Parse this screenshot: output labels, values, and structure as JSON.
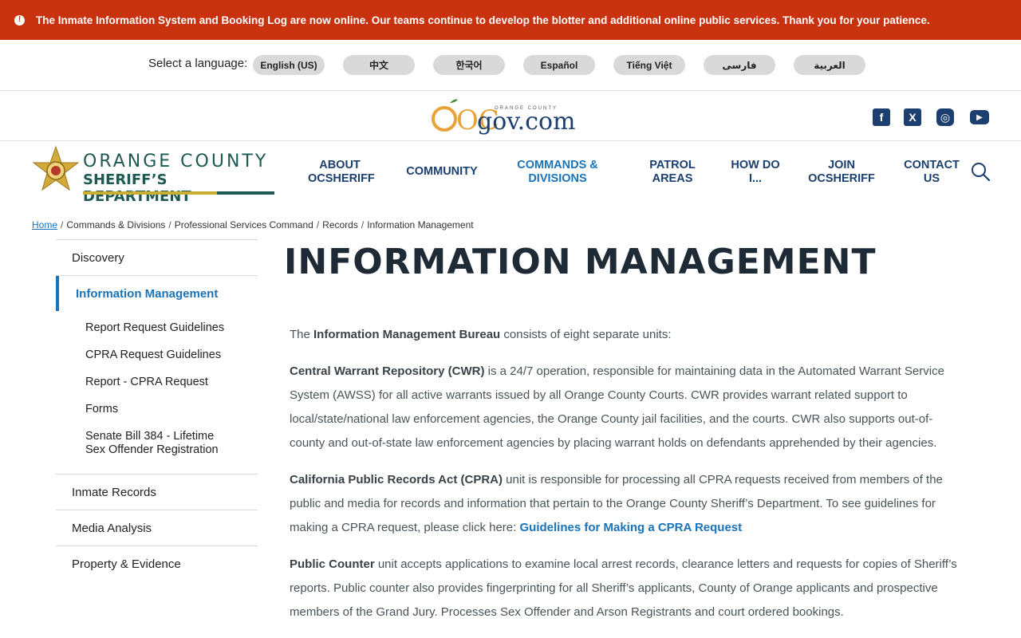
{
  "alert": {
    "icon": "alert-icon",
    "text": "The Inmate Information System and Booking Log are now online. Our teams continue to develop the blotter and additional online public services. Thank you for your patience."
  },
  "language": {
    "label": "Select a language:",
    "options": [
      "English (US)",
      "中文",
      "한국어",
      "Español",
      "Tiếng Việt",
      "فارسی",
      "العربية"
    ]
  },
  "ocgov": {
    "small_text": "ORANGE COUNTY",
    "oc": "OC",
    "site": "gov.com"
  },
  "social": {
    "facebook": "f",
    "x": "X",
    "instagram": "◎",
    "youtube": "▶"
  },
  "brand": {
    "line1": "ORANGE COUNTY",
    "line2": "SHERIFF’S DEPARTMENT"
  },
  "nav": [
    "ABOUT OCSHERIFF",
    "COMMUNITY",
    "COMMANDS & DIVISIONS",
    "PATROL AREAS",
    "HOW DO I...",
    "JOIN OCSHERIFF",
    "CONTACT US"
  ],
  "nav_lines": {
    "about1": "ABOUT",
    "about2": "OCSHERIFF",
    "community": "COMMUNITY",
    "cmd1": "COMMANDS &",
    "cmd2": "DIVISIONS",
    "patrol1": "PATROL",
    "patrol2": "AREAS",
    "how1": "HOW DO",
    "how2": "I...",
    "join1": "JOIN",
    "join2": "OCSHERIFF",
    "contact1": "CONTACT",
    "contact2": "US"
  },
  "breadcrumb": {
    "home": "Home",
    "c1": "Commands & Divisions",
    "c2": "Professional Services Command",
    "c3": "Records",
    "c4": "Information Management"
  },
  "sidebar": {
    "discovery": "Discovery",
    "current": "Information Management",
    "subitems": {
      "s1": "Report Request Guidelines",
      "s2": "CPRA Request Guidelines",
      "s3": "Report - CPRA Request",
      "s4": "Forms",
      "s5a": "Senate Bill 384 - Lifetime",
      "s5b": "Sex Offender Registration"
    },
    "inmate": "Inmate Records",
    "media": "Media Analysis",
    "property": "Property & Evidence"
  },
  "page": {
    "title": "INFORMATION MANAGEMENT",
    "intro_pre": "The ",
    "intro_bold": "Information Management Bureau",
    "intro_post": " consists of eight separate units:",
    "cwr_bold": "Central Warrant Repository (CWR)",
    "cwr_text": " is a 24/7 operation, responsible for maintaining data in the Automated Warrant Service System (AWSS) for all active warrants issued by all Orange County Courts. CWR provides warrant related support to local/state/national law enforcement agencies, the Orange County jail facilities, and the courts. CWR also supports out-of-county and out-of-state law enforcement agencies by placing warrant holds on defendants apprehended by their agencies.",
    "cpra_bold": "California Public Records Act (CPRA)",
    "cpra_text": " unit is responsible for processing all CPRA requests received from members of the public and media for records and information that pertain to the Orange County Sheriff’s Department. To see guidelines for making a CPRA request, please click here: ",
    "cpra_link": "Guidelines for Making a CPRA Request",
    "pc_bold": "Public Counter",
    "pc_text": " unit accepts applications to examine local arrest records, clearance letters and requests for copies of Sheriff’s reports.  Public counter also provides fingerprinting for all Sheriff’s applicants, County of Orange applicants and prospective members of the Grand Jury. Processes Sex Offender and Arson Registrants and court ordered bookings."
  }
}
